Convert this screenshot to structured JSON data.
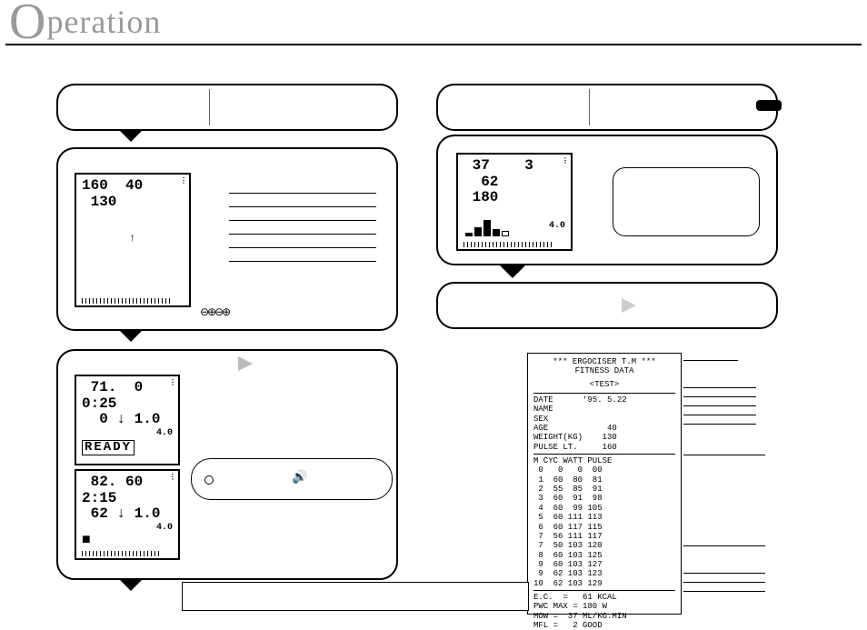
{
  "page": {
    "title_big": "O",
    "title_rest": "peration"
  },
  "panel2_lcd": {
    "line1": "160  40",
    "line2": " 130",
    "arrow": "↑"
  },
  "panel2_btn_hint": "⊖⊕⊖⊕",
  "panel3_lcd_a": {
    "line1": " 71.  0",
    "line2": "0:25",
    "line3": "  0 ↓ 1.0",
    "line4_small": "4.0",
    "readout": "READY"
  },
  "panel3_lcd_b": {
    "line1": " 82. 60",
    "line2": "2:15",
    "line3": " 62 ↓ 1.0",
    "line4_small": "4.0",
    "block": "■"
  },
  "panel3_speaker_icon": "🔊",
  "panel5_lcd": {
    "line1": " 37    3",
    "line2": "  62",
    "line3": " 180",
    "side_small": "4.0",
    "bars": [
      4,
      10,
      18,
      8,
      6
    ],
    "bars_outline_last": true
  },
  "printout": {
    "header1": "*** ERGOCISER T.M ***",
    "header2": "FITNESS DATA",
    "mode": "<TEST>",
    "kv": [
      "DATE      '95. 5.22",
      "NAME",
      "SEX",
      "AGE            40",
      "WEIGHT(KG)    130",
      "PULSE LT.     160"
    ],
    "table_header": "M CYC WATT PULSE",
    "rows": [
      " 0   0   0  00",
      " 1  60  80  81",
      " 2  55  85  91",
      " 3  60  91  98",
      " 4  60  99 105",
      " 5  60 111 113",
      " 6  60 117 115",
      " 7  56 111 117",
      " 7  50 103 120",
      " 8  60 103 125",
      " 9  60 103 127",
      " 9  62 103 123",
      "10  62 103 129"
    ],
    "footer": [
      "E.C.  =   61 KCAL",
      "PWC MAX = 180 W",
      "MOW =  37 ML/KG.MIN",
      "MFL =   2 GOOD"
    ]
  }
}
